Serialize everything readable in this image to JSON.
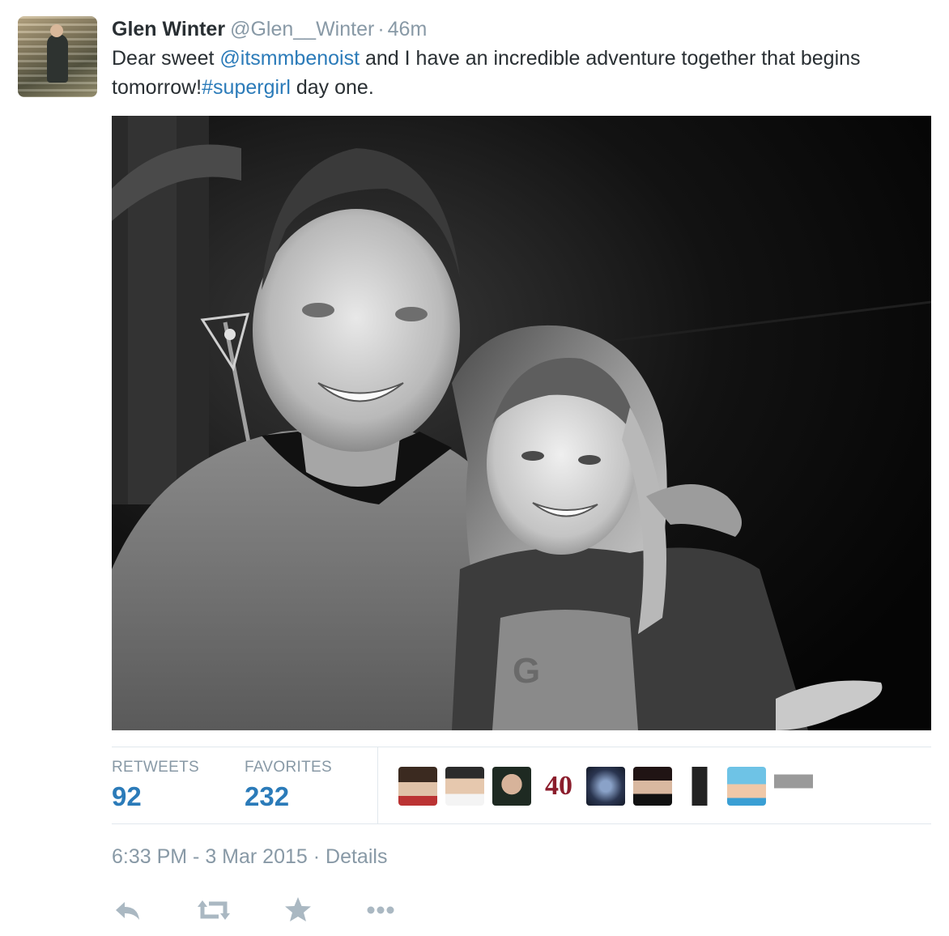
{
  "tweet": {
    "author_name": "Glen Winter",
    "author_handle": "@Glen__Winter",
    "separator": "·",
    "time_ago": "46m",
    "text_parts": {
      "t1": "Dear sweet ",
      "mention": "@itsmmbenoist",
      "t2": " and I have an incredible adventure together that begins tomorrow!",
      "hashtag": "#supergirl",
      "t3": " day one."
    }
  },
  "stats": {
    "retweets_label": "RETWEETS",
    "retweets_count": "92",
    "favorites_label": "FAVORITES",
    "favorites_count": "232"
  },
  "favoriters_badge_text": "40",
  "meta": {
    "timestamp": "6:33 PM - 3 Mar 2015",
    "separator": "·",
    "details_label": "Details"
  },
  "colors": {
    "link": "#2b7bb9",
    "muted": "#8899a6",
    "text": "#292f33",
    "border": "#e1e8ed"
  },
  "icons": [
    "reply-icon",
    "retweet-icon",
    "favorite-star-icon",
    "more-ellipsis-icon"
  ]
}
